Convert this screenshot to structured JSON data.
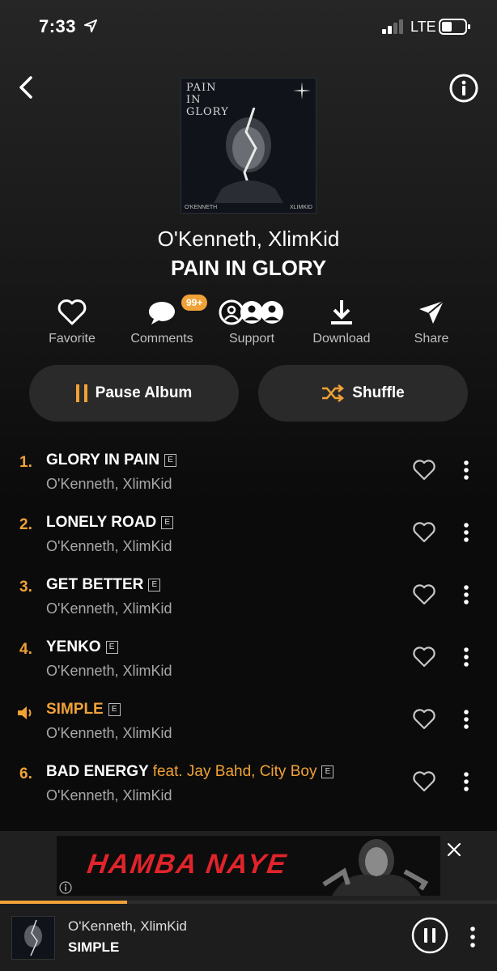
{
  "status": {
    "time": "7:33",
    "network": "LTE"
  },
  "nav": {
    "back_icon": "chevron-left-icon",
    "info_icon": "info-icon"
  },
  "cover": {
    "text_lines": [
      "PAIN",
      "IN",
      "GLORY"
    ],
    "footer_left": "O'KENNETH",
    "footer_right": "XLIMKID"
  },
  "album": {
    "artist": "O'Kenneth, XlimKid",
    "title": "PAIN IN GLORY"
  },
  "actions": [
    {
      "label": "Favorite",
      "icon": "heart-icon"
    },
    {
      "label": "Comments",
      "icon": "comment-icon",
      "badge": "99+"
    },
    {
      "label": "Support",
      "icon": "support-icon"
    },
    {
      "label": "Download",
      "icon": "download-icon"
    },
    {
      "label": "Share",
      "icon": "share-icon"
    }
  ],
  "buttons": {
    "pause": "Pause Album",
    "shuffle": "Shuffle"
  },
  "tracks": [
    {
      "number": "1.",
      "title": "GLORY IN PAIN",
      "feat": "",
      "artist": "O'Kenneth, XlimKid",
      "explicit": "E",
      "playing": false
    },
    {
      "number": "2.",
      "title": "LONELY ROAD",
      "feat": "",
      "artist": "O'Kenneth, XlimKid",
      "explicit": "E",
      "playing": false
    },
    {
      "number": "3.",
      "title": "GET BETTER",
      "feat": "",
      "artist": "O'Kenneth, XlimKid",
      "explicit": "E",
      "playing": false
    },
    {
      "number": "4.",
      "title": "YENKO",
      "feat": "",
      "artist": "O'Kenneth, XlimKid",
      "explicit": "E",
      "playing": false
    },
    {
      "number": "",
      "title": "SIMPLE",
      "feat": "",
      "artist": "O'Kenneth, XlimKid",
      "explicit": "E",
      "playing": true
    },
    {
      "number": "6.",
      "title": "BAD ENERGY",
      "feat": "feat. Jay Bahd, City Boy",
      "artist": "O'Kenneth, XlimKid",
      "explicit": "E",
      "playing": false
    }
  ],
  "ad": {
    "headline": "HAMBA NAYE"
  },
  "player": {
    "artist": "O'Kenneth, XlimKid",
    "title": "SIMPLE",
    "progress": 0.255
  },
  "colors": {
    "accent": "#f0a236",
    "background": "#0b0b0b",
    "button": "#2a2a2a"
  }
}
